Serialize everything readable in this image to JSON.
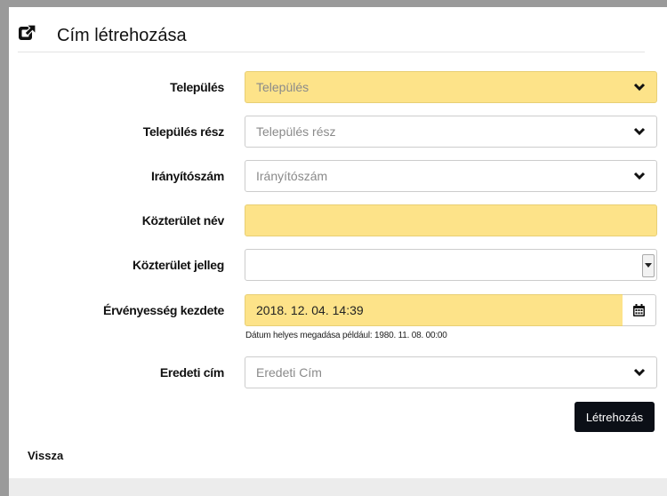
{
  "header": {
    "title": "Cím létrehozása",
    "icon": "external-link-icon"
  },
  "form": {
    "settlement": {
      "label": "Település",
      "placeholder": "Település"
    },
    "settlement_part": {
      "label": "Település rész",
      "placeholder": "Település rész"
    },
    "postal_code": {
      "label": "Irányítószám",
      "placeholder": "Irányítószám"
    },
    "street_name": {
      "label": "Közterület név",
      "value": ""
    },
    "street_type": {
      "label": "Közterület jelleg",
      "value": ""
    },
    "validity_start": {
      "label": "Érvényesség kezdete",
      "value": "2018. 12. 04. 14:39",
      "hint": "Dátum helyes megadása például: 1980. 11. 08. 00:00"
    },
    "original_address": {
      "label": "Eredeti cím",
      "placeholder": "Eredeti Cím"
    }
  },
  "actions": {
    "create_label": "Létrehozás",
    "back_label": "Vissza"
  },
  "colors": {
    "required_bg": "#fde389",
    "button_bg": "#0b0f16"
  }
}
